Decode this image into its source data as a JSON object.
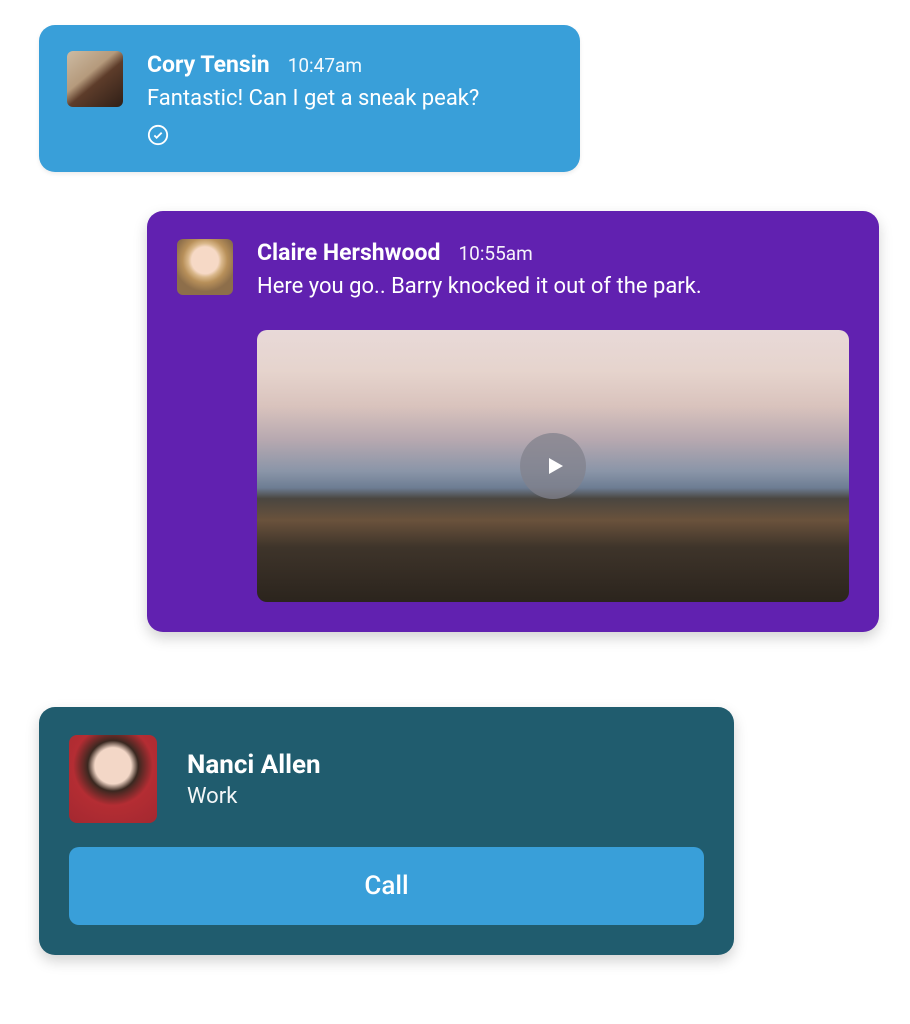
{
  "messages": [
    {
      "sender": "Cory Tensin",
      "time": "10:47am",
      "text": "Fantastic! Can I get a sneak peak?"
    },
    {
      "sender": "Claire Hershwood",
      "time": "10:55am",
      "text": "Here you go.. Barry knocked it out of the park."
    }
  ],
  "contact": {
    "name": "Nanci Allen",
    "subtitle": "Work",
    "call_label": "Call"
  }
}
